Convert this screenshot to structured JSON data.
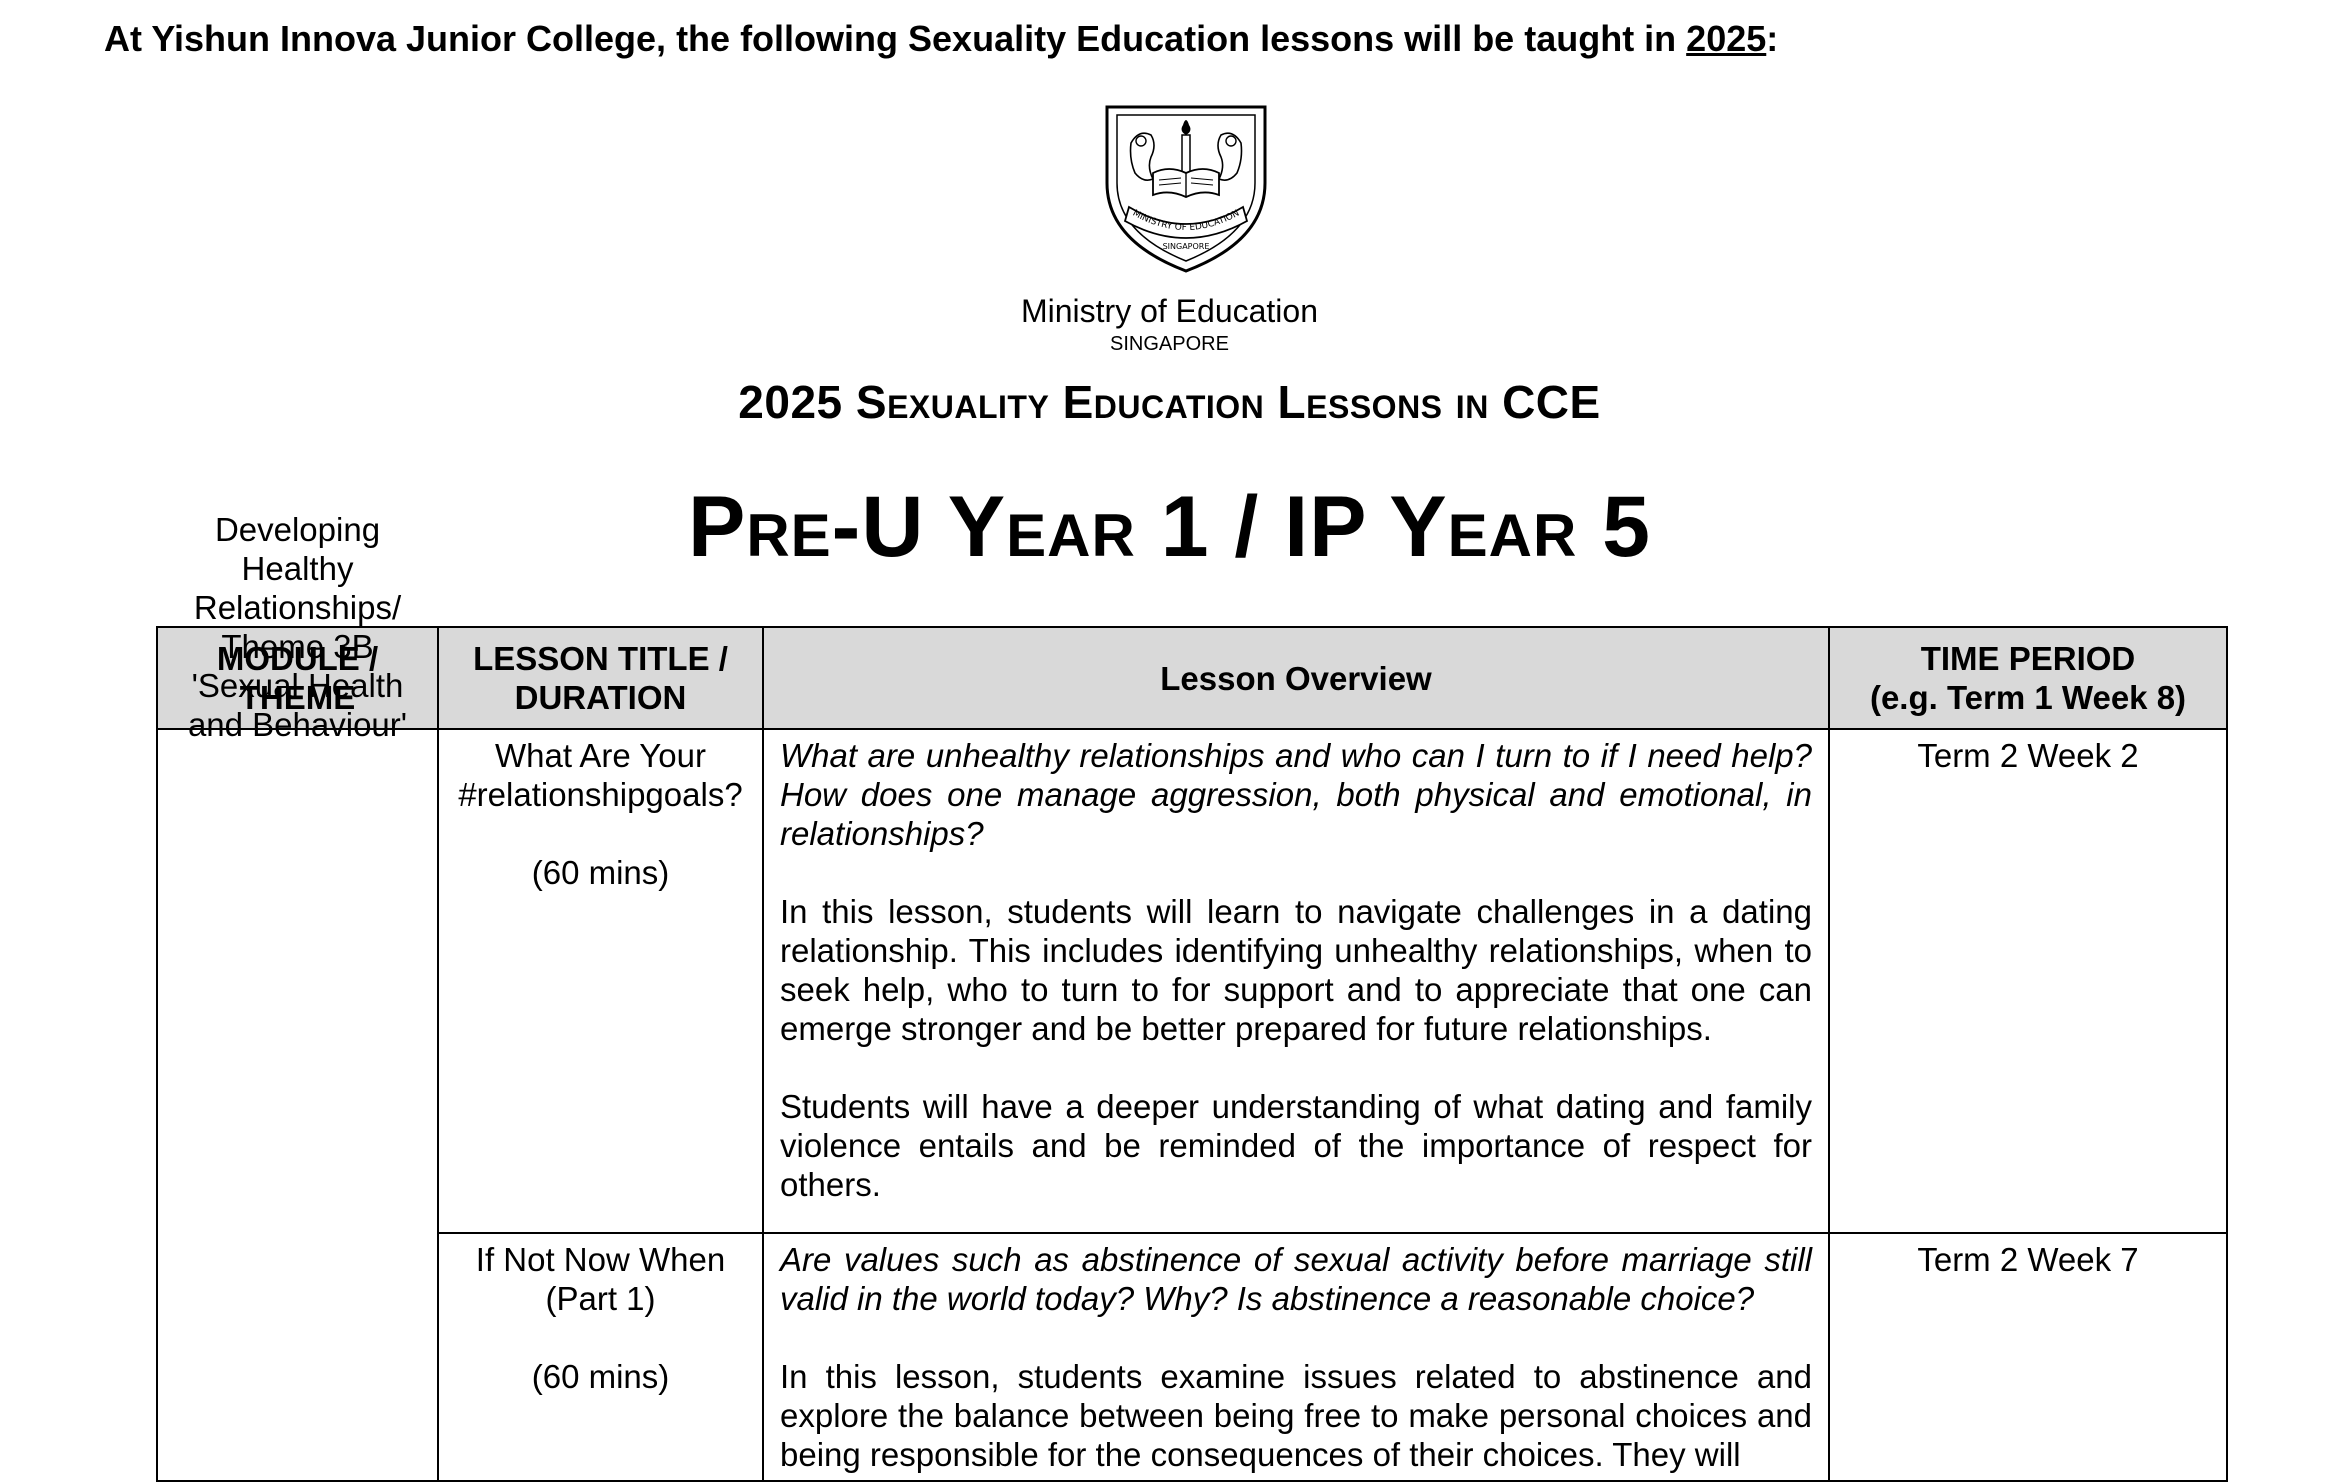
{
  "intro": {
    "prefix": "At Yishun Innova Junior College, the following Sexuality Education lessons will be taught in ",
    "year": "2025",
    "suffix": ":"
  },
  "crest": {
    "ribbon_text": "MINISTRY OF EDUCATION",
    "country_text": "SINGAPORE"
  },
  "ministry": {
    "name": "Ministry of Education",
    "country": "SINGAPORE"
  },
  "heading": "2025 Sexuality Education Lessons in CCE",
  "year_level": "Pre-U Year 1 / IP Year 5",
  "table": {
    "headers": {
      "module": "MODULE / THEME",
      "lesson": "LESSON TITLE / DURATION",
      "overview": "Lesson Overview",
      "time_line1": "TIME PERIOD",
      "time_line2": "(e.g. Term 1 Week 8)"
    },
    "module_theme": "Developing Healthy Relationships/ Theme 3B 'Sexual Health and Behaviour'",
    "rows": [
      {
        "title": "What Are Your #relationshipgoals?",
        "duration": "(60 mins)",
        "question": "What are unhealthy relationships and who can I turn to if I need help? How does one manage aggression, both physical and emotional, in relationships?",
        "para1": "In this lesson, students will learn to navigate challenges in a dating relationship. This includes identifying unhealthy relationships, when to seek help, who to turn to for support and to appreciate that one can emerge stronger and be better prepared for future relationships.",
        "para2": "Students will have a deeper understanding of what dating and family violence entails and be reminded of the importance of respect for others.",
        "time": "Term 2 Week 2"
      },
      {
        "title": "If Not Now When (Part 1)",
        "duration": "(60 mins)",
        "question": "Are values such as abstinence of sexual activity before marriage still valid in the world today? Why? Is abstinence a reasonable choice?",
        "para1": "In this lesson, students examine issues related to abstinence and explore the balance between being free to make personal choices and being responsible for the consequences of their choices. They will",
        "time": "Term 2 Week 7"
      }
    ]
  }
}
